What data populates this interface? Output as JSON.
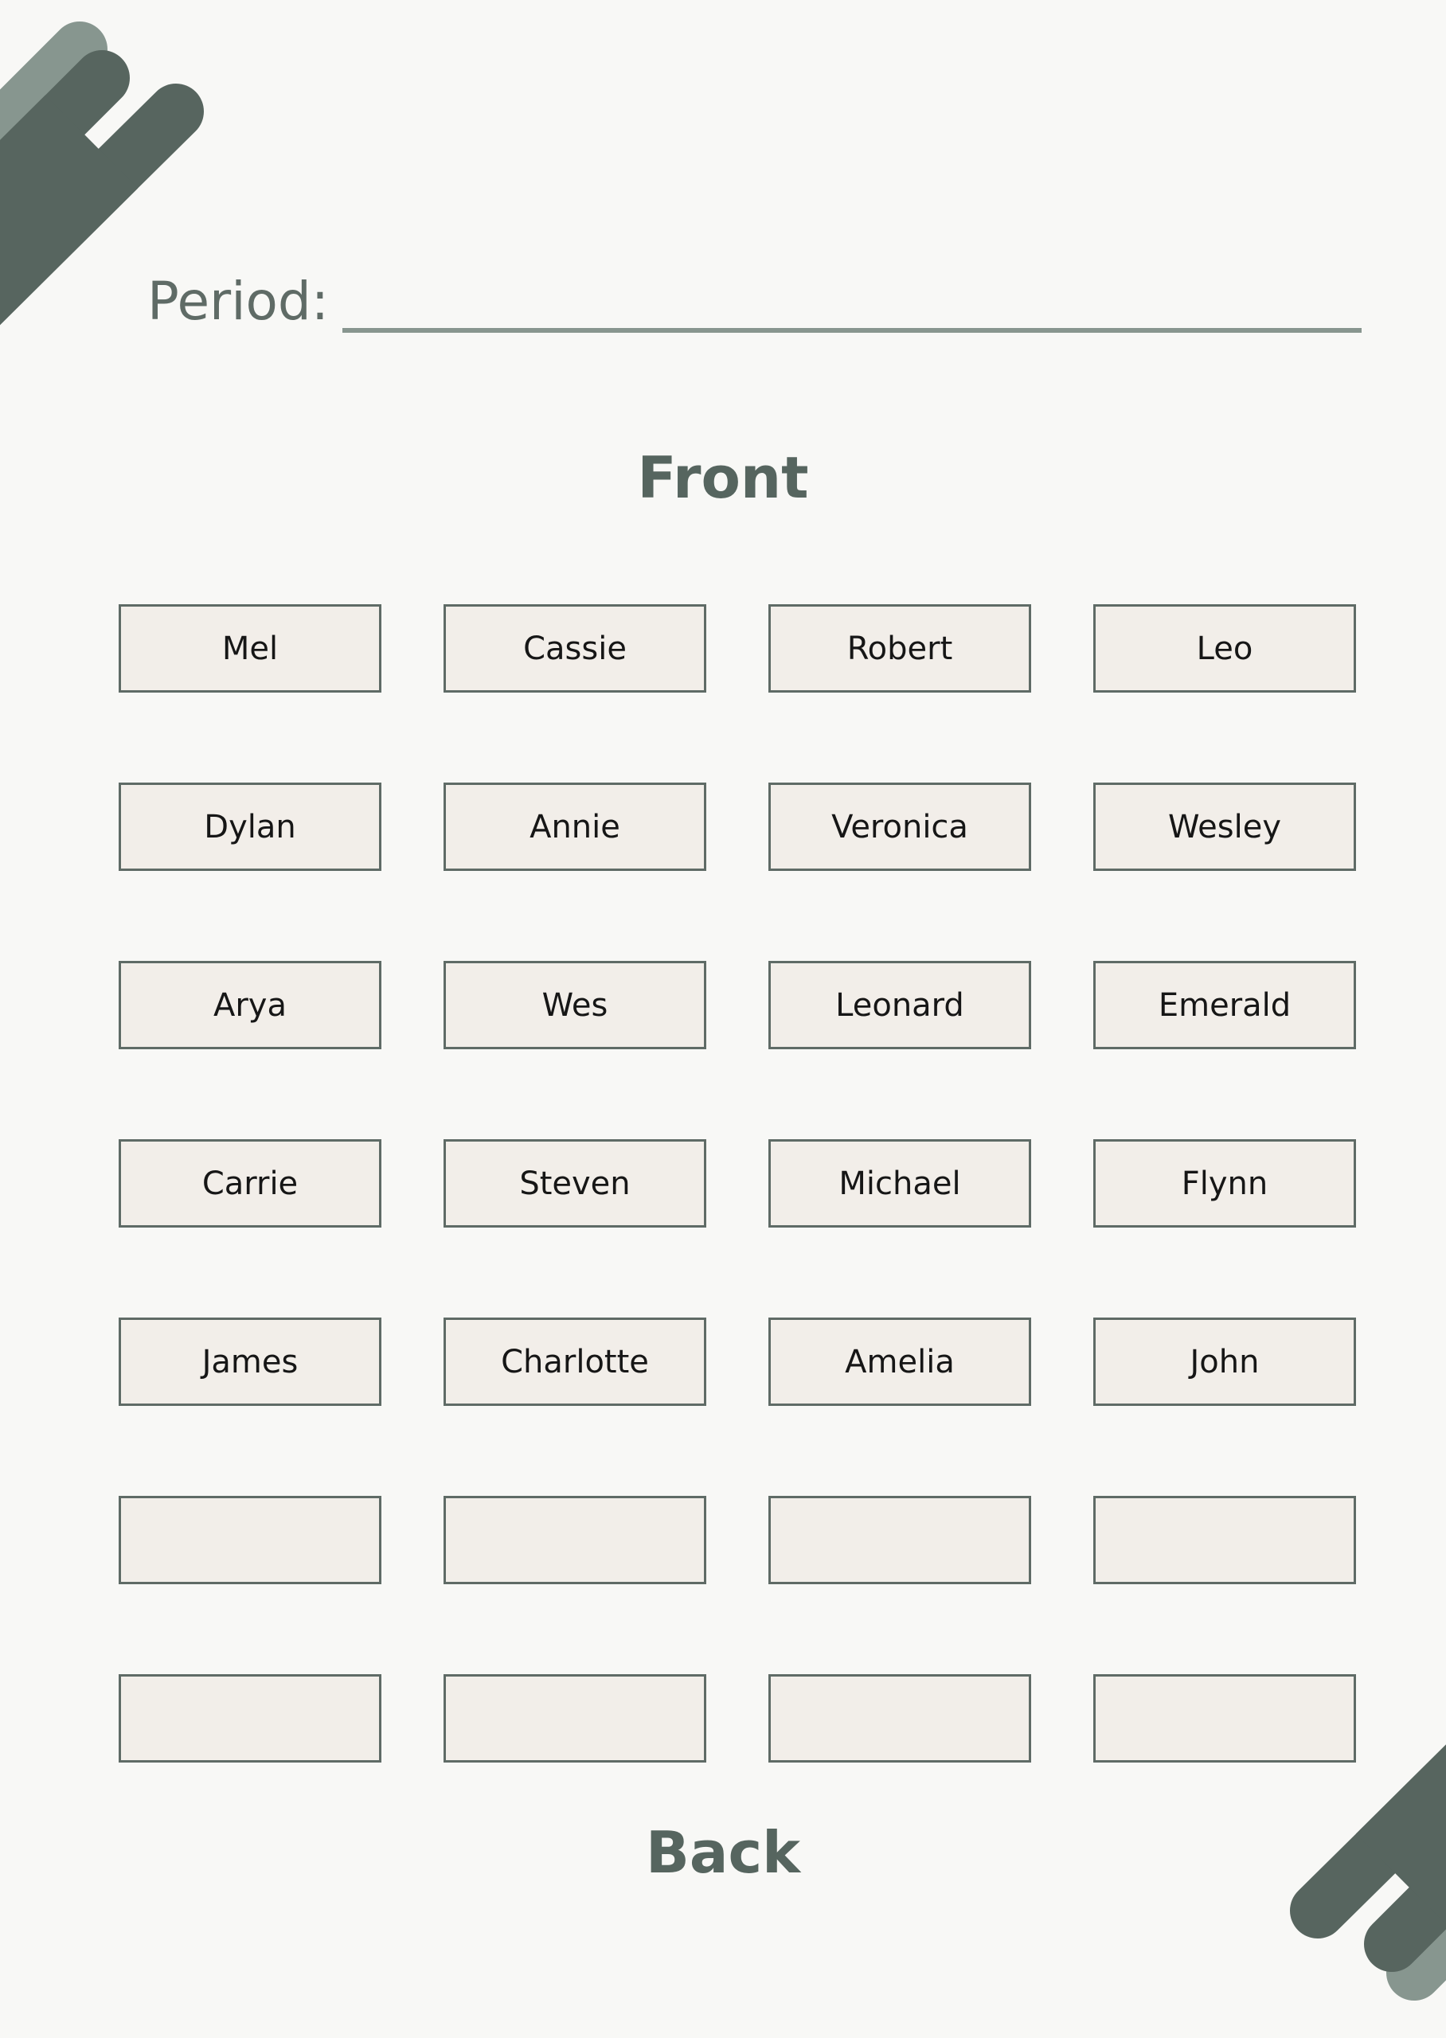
{
  "period": {
    "label": "Period:",
    "value": ""
  },
  "sections": {
    "front": "Front",
    "back": "Back"
  },
  "seats": [
    "Mel",
    "Cassie",
    "Robert",
    "Leo",
    "Dylan",
    "Annie",
    "Veronica",
    "Wesley",
    "Arya",
    "Wes",
    "Leonard",
    "Emerald",
    "Carrie",
    "Steven",
    "Michael",
    "Flynn",
    "James",
    "Charlotte",
    "Amelia",
    "John",
    "",
    "",
    "",
    "",
    "",
    "",
    "",
    ""
  ],
  "colors": {
    "background": "#f8f8f6",
    "dark_accent": "#57655f",
    "light_accent": "#87968f",
    "seat_fill": "#f2eee9",
    "seat_border": "#5f6b66"
  }
}
